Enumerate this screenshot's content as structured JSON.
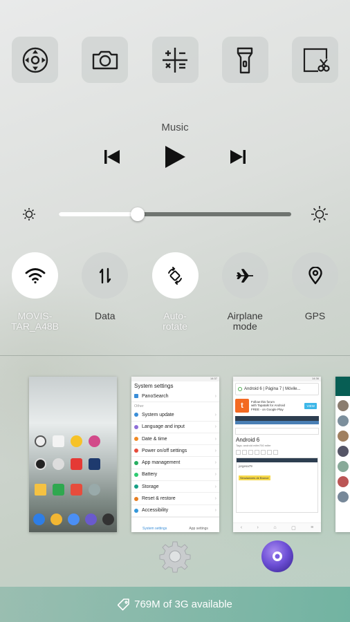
{
  "shortcuts": [
    {
      "name": "navigation-shortcut",
      "icon": "dpad-icon"
    },
    {
      "name": "camera-shortcut",
      "icon": "camera-icon"
    },
    {
      "name": "calculator-shortcut",
      "icon": "calculator-icon"
    },
    {
      "name": "flashlight-shortcut",
      "icon": "flashlight-icon"
    },
    {
      "name": "screenshot-shortcut",
      "icon": "screenshot-scissors-icon"
    }
  ],
  "music": {
    "title": "Music",
    "controls": [
      "previous-icon",
      "play-icon",
      "next-icon"
    ]
  },
  "brightness": {
    "level": 0.34
  },
  "toggles": [
    {
      "label": "MOVIS-\nTAR_A48B",
      "icon": "wifi-icon",
      "on": true
    },
    {
      "label": "Data",
      "icon": "data-arrows-icon",
      "on": false
    },
    {
      "label": "Auto-\nrotate",
      "icon": "auto-rotate-icon",
      "on": true
    },
    {
      "label": "Airplane\nmode",
      "icon": "airplane-icon",
      "on": false
    },
    {
      "label": "GPS",
      "icon": "location-pin-icon",
      "on": false
    }
  ],
  "recents": {
    "settings": {
      "status_time": "14:37",
      "title": "System settings",
      "top_item": "PanoSearch",
      "section": "Other",
      "items": [
        {
          "label": "System update",
          "color": "#3a8ed8"
        },
        {
          "label": "Language and input",
          "color": "#8e6fd8"
        },
        {
          "label": "Date & time",
          "color": "#f08a24"
        },
        {
          "label": "Power on/off settings",
          "color": "#e74c3c"
        },
        {
          "label": "App management",
          "color": "#27ae60"
        },
        {
          "label": "Battery",
          "color": "#2ecc71"
        },
        {
          "label": "Storage",
          "color": "#16a085"
        },
        {
          "label": "Reset & restore",
          "color": "#e67e22"
        },
        {
          "label": "Accessibility",
          "color": "#3498db"
        }
      ],
      "tabs": [
        "System settings",
        "App settings"
      ]
    },
    "browser": {
      "status_time": "14:36",
      "url_text": "Android 6 | Página 7 | Móvile...",
      "ad_line1": "Follow this forum",
      "ad_line2": "with Tapatalk for Android",
      "ad_line3": "FREE - on Google Play",
      "ad_button": "VIEW",
      "heading": "Android 6",
      "tags": "Tags:  android   mifer750   mifer",
      "user": "jorgesa79",
      "badge": "Simuladores de Bronce"
    }
  },
  "storage": {
    "text": "769M of 3G available",
    "icon": "clean-tag-icon"
  }
}
